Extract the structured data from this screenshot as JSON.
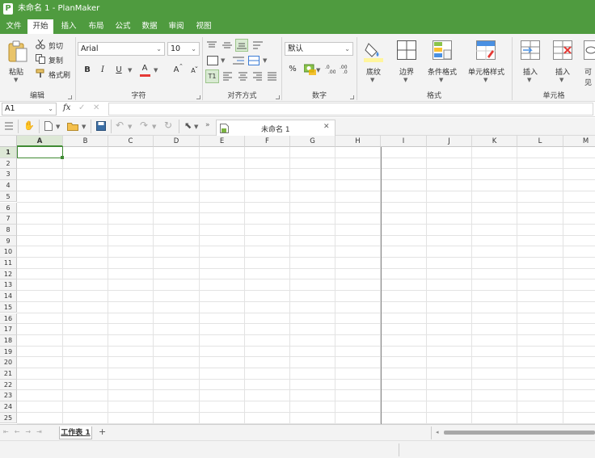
{
  "window": {
    "title": "未命名 1 - PlanMaker",
    "app_icon": "P"
  },
  "menu": [
    "文件",
    "开始",
    "插入",
    "布局",
    "公式",
    "数据",
    "审阅",
    "视图"
  ],
  "ribbon": {
    "clipboard": {
      "paste": "粘贴",
      "cut": "剪切",
      "copy": "复制",
      "format_painter": "格式刷",
      "label": "编辑"
    },
    "font": {
      "font_name": "Arial",
      "font_size": "10",
      "bold": "B",
      "italic": "I",
      "underline": "U",
      "color": "A",
      "grow": "A",
      "shrink": "A",
      "label": "字符"
    },
    "alignment": {
      "label": "对齐方式",
      "t1": "T1"
    },
    "number": {
      "format": "默认",
      "percent": "%",
      "label": "数字"
    },
    "style": {
      "shading": "底纹",
      "border": "边界",
      "conditional": "条件格式",
      "cell_style": "单元格样式",
      "label": "格式"
    },
    "cells": {
      "insert1": "插入",
      "insert2": "插入",
      "visible": "可见",
      "label": "单元格"
    }
  },
  "formula_bar": {
    "cell_ref": "A1",
    "fx": "fx",
    "value": ""
  },
  "document_tab": {
    "name": "未命名 1"
  },
  "columns": [
    "A",
    "B",
    "C",
    "D",
    "E",
    "F",
    "G",
    "H",
    "I",
    "J",
    "K",
    "L",
    "M"
  ],
  "rows": [
    "1",
    "2",
    "3",
    "4",
    "5",
    "6",
    "7",
    "8",
    "9",
    "10",
    "11",
    "12",
    "13",
    "14",
    "15",
    "16",
    "17",
    "18",
    "19",
    "20",
    "21",
    "22",
    "23",
    "24",
    "25"
  ],
  "sheet_tabs": [
    {
      "name": "工作表 1",
      "active": true
    }
  ],
  "add_sheet": "+"
}
